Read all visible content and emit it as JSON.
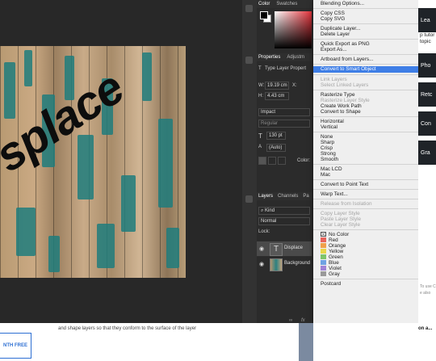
{
  "canvas": {
    "text_layer_content": "splace"
  },
  "color_panel": {
    "tabs": [
      "Color",
      "Swatches"
    ]
  },
  "properties_panel": {
    "tabs": [
      "Properties",
      "Adjustm"
    ],
    "layer_type": "Type Layer Propert",
    "width_label": "W:",
    "width_value": "19.19 cm",
    "x_label": "X:",
    "height_label": "H:",
    "height_value": "4.43 cm",
    "font_family": "Impact",
    "font_style": "Regular",
    "font_size": "130 pt",
    "leading": "(Auto)",
    "color_label": "Color:"
  },
  "layers_panel": {
    "tabs": [
      "Layers",
      "Channels",
      "Pa"
    ],
    "filter": "Kind",
    "blend_mode": "Normal",
    "lock_label": "Lock:",
    "layers": [
      {
        "name": "Displace",
        "type": "text"
      },
      {
        "name": "Background",
        "type": "image"
      }
    ],
    "footer_icons": [
      "link-icon",
      "fx-icon"
    ]
  },
  "context_menu": {
    "items": [
      {
        "label": "Blending Options...",
        "state": "normal"
      },
      {
        "sep": true
      },
      {
        "label": "Copy CSS",
        "state": "normal"
      },
      {
        "label": "Copy SVG",
        "state": "normal"
      },
      {
        "sep": true
      },
      {
        "label": "Duplicate Layer...",
        "state": "normal"
      },
      {
        "label": "Delete Layer",
        "state": "normal"
      },
      {
        "sep": true
      },
      {
        "label": "Quick Export as PNG",
        "state": "normal"
      },
      {
        "label": "Export As...",
        "state": "normal"
      },
      {
        "sep": true
      },
      {
        "label": "Artboard from Layers...",
        "state": "normal"
      },
      {
        "sep": true
      },
      {
        "label": "Convert to Smart Object",
        "state": "selected"
      },
      {
        "sep": true
      },
      {
        "label": "Link Layers",
        "state": "disabled"
      },
      {
        "label": "Select Linked Layers",
        "state": "disabled"
      },
      {
        "sep": true
      },
      {
        "label": "Rasterize Type",
        "state": "normal"
      },
      {
        "label": "Rasterize Layer Style",
        "state": "disabled"
      },
      {
        "label": "Create Work Path",
        "state": "normal"
      },
      {
        "label": "Convert to Shape",
        "state": "normal"
      },
      {
        "sep": true
      },
      {
        "label": "Horizontal",
        "state": "normal"
      },
      {
        "label": "Vertical",
        "state": "normal"
      },
      {
        "sep": true
      },
      {
        "label": "None",
        "state": "normal"
      },
      {
        "label": "Sharp",
        "state": "normal"
      },
      {
        "label": "Crisp",
        "state": "normal"
      },
      {
        "label": "Strong",
        "state": "normal"
      },
      {
        "label": "Smooth",
        "state": "normal"
      },
      {
        "sep": true
      },
      {
        "label": "Mac LCD",
        "state": "normal"
      },
      {
        "label": "Mac",
        "state": "normal"
      },
      {
        "sep": true
      },
      {
        "label": "Convert to Point Text",
        "state": "normal"
      },
      {
        "sep": true
      },
      {
        "label": "Warp Text...",
        "state": "normal"
      },
      {
        "sep": true
      },
      {
        "label": "Release from Isolation",
        "state": "disabled"
      },
      {
        "sep": true
      },
      {
        "label": "Copy Layer Style",
        "state": "disabled"
      },
      {
        "label": "Paste Layer Style",
        "state": "disabled"
      },
      {
        "label": "Clear Layer Style",
        "state": "disabled"
      },
      {
        "sep": true
      },
      {
        "label": "No Color",
        "state": "normal",
        "swatch": "none"
      },
      {
        "label": "Red",
        "state": "normal",
        "swatch": "#e8635c"
      },
      {
        "label": "Orange",
        "state": "normal",
        "swatch": "#f0a04a"
      },
      {
        "label": "Yellow",
        "state": "normal",
        "swatch": "#e9d64a"
      },
      {
        "label": "Green",
        "state": "normal",
        "swatch": "#7ec46a"
      },
      {
        "label": "Blue",
        "state": "normal",
        "swatch": "#6fa3e3"
      },
      {
        "label": "Violet",
        "state": "normal",
        "swatch": "#9f83d6"
      },
      {
        "label": "Gray",
        "state": "normal",
        "swatch": "#9a9a9a"
      },
      {
        "sep": true
      },
      {
        "label": "Postcard",
        "state": "normal"
      }
    ]
  },
  "web_page": {
    "caption": "and shape layers so that they conform to the surface of the layer",
    "button_label": "NTH FREE",
    "right_caption": "on a...",
    "right_panel": {
      "boxes": [
        "Lea",
        "Pho",
        "Retc",
        "Con",
        "Gra"
      ],
      "texts": [
        "p tutor",
        "topic",
        "To use C",
        "e also"
      ]
    }
  }
}
